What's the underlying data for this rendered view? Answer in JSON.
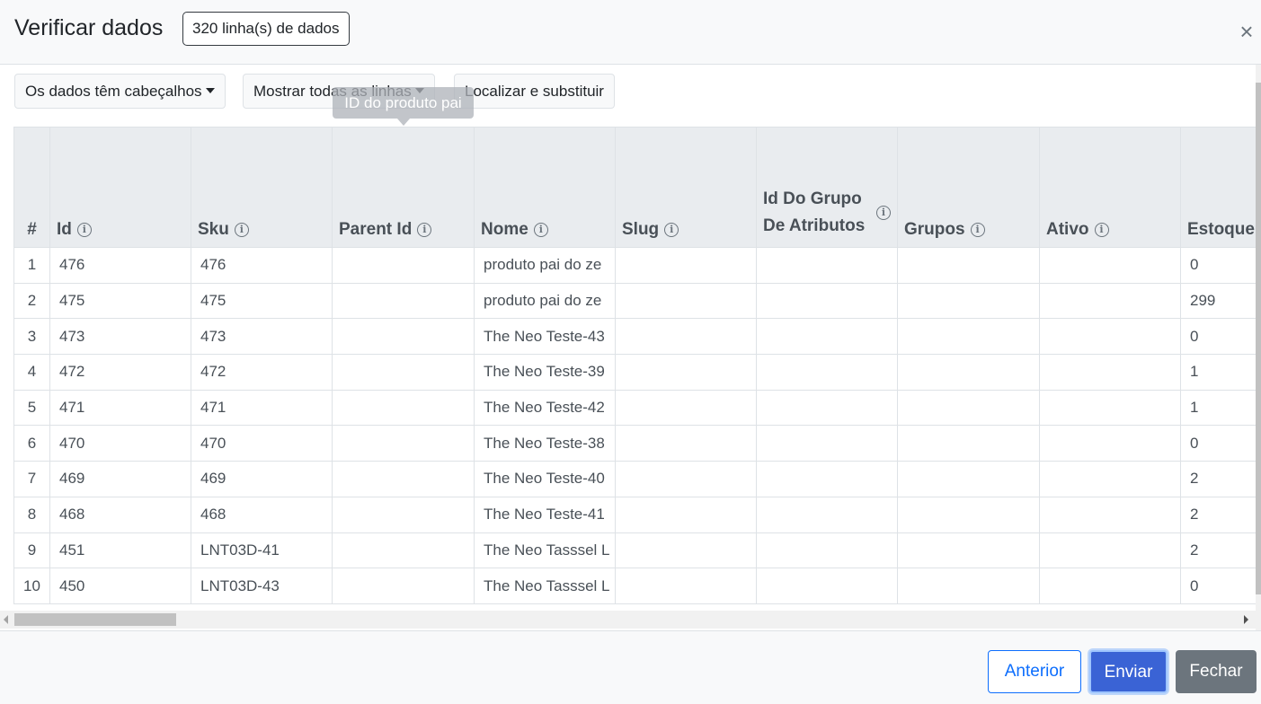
{
  "header": {
    "title": "Verificar dados",
    "row_count": "320 linha(s) de dados",
    "close_glyph": "×"
  },
  "toolbar": {
    "headers_dropdown": "Os dados têm cabeçalhos",
    "rows_dropdown": "Mostrar todas as linhas",
    "find_replace": "Localizar e substituir"
  },
  "tooltip": {
    "text": "ID do produto pai"
  },
  "table": {
    "columns": [
      {
        "label": "#"
      },
      {
        "label": "Id"
      },
      {
        "label": "Sku"
      },
      {
        "label": "Parent Id"
      },
      {
        "label": "Nome"
      },
      {
        "label": "Slug"
      },
      {
        "label": "Id Do Grupo De Atributos"
      },
      {
        "label": "Grupos"
      },
      {
        "label": "Ativo"
      },
      {
        "label": "Estoque"
      }
    ],
    "rows": [
      [
        "1",
        "476",
        "476",
        "",
        "produto pai do ze",
        "",
        "",
        "",
        "",
        "0"
      ],
      [
        "2",
        "475",
        "475",
        "",
        "produto pai do ze",
        "",
        "",
        "",
        "",
        "299"
      ],
      [
        "3",
        "473",
        "473",
        "",
        "The Neo Teste-43",
        "",
        "",
        "",
        "",
        "0"
      ],
      [
        "4",
        "472",
        "472",
        "",
        "The Neo Teste-39",
        "",
        "",
        "",
        "",
        "1"
      ],
      [
        "5",
        "471",
        "471",
        "",
        "The Neo Teste-42",
        "",
        "",
        "",
        "",
        "1"
      ],
      [
        "6",
        "470",
        "470",
        "",
        "The Neo Teste-38",
        "",
        "",
        "",
        "",
        "0"
      ],
      [
        "7",
        "469",
        "469",
        "",
        "The Neo Teste-40",
        "",
        "",
        "",
        "",
        "2"
      ],
      [
        "8",
        "468",
        "468",
        "",
        "The Neo Teste-41",
        "",
        "",
        "",
        "",
        "2"
      ],
      [
        "9",
        "451",
        "LNT03D-41",
        "",
        "The Neo Tasssel L",
        "",
        "",
        "",
        "",
        "2"
      ],
      [
        "10",
        "450",
        "LNT03D-43",
        "",
        "The Neo Tasssel L",
        "",
        "",
        "",
        "",
        "0"
      ]
    ]
  },
  "footer": {
    "previous": "Anterior",
    "submit": "Enviar",
    "close": "Fechar"
  },
  "icons": {
    "info": "info-circle-icon",
    "close": "close-icon",
    "caret": "caret-down-icon"
  },
  "colors": {
    "primary": "#0d6efd",
    "submit_bg": "#3a63d5",
    "secondary": "#6c757d",
    "header_bg": "#e9ecef"
  }
}
